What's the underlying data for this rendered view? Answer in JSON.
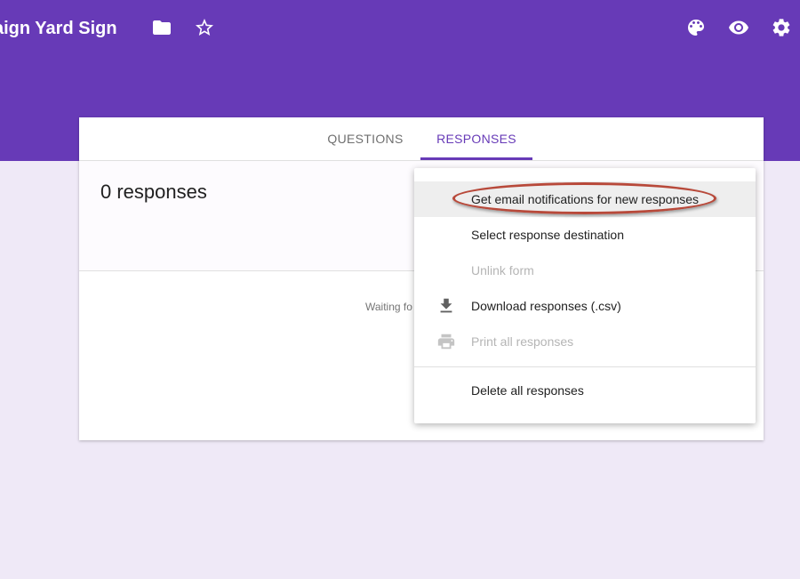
{
  "header": {
    "title": "mpaign Yard Sign",
    "icons": {
      "folder": "folder-icon",
      "star": "star-outline-icon",
      "palette": "palette-icon",
      "preview": "eye-icon",
      "settings": "gear-icon"
    },
    "color": "#673ab7"
  },
  "tabs": [
    {
      "label": "QUESTIONS",
      "active": false
    },
    {
      "label": "RESPONSES",
      "active": true
    }
  ],
  "summary": {
    "count_label": "0 responses",
    "waiting_text": "Waiting fo"
  },
  "menu": {
    "items": [
      {
        "label": "Get email notifications for new responses",
        "icon": "",
        "disabled": false,
        "highlighted": true
      },
      {
        "label": "Select response destination",
        "icon": "",
        "disabled": false,
        "highlighted": false
      },
      {
        "label": "Unlink form",
        "icon": "",
        "disabled": true,
        "highlighted": false
      },
      {
        "label": "Download responses (.csv)",
        "icon": "download-icon",
        "disabled": false,
        "highlighted": false
      },
      {
        "label": "Print all responses",
        "icon": "printer-icon",
        "disabled": true,
        "highlighted": false
      },
      {
        "label": "Delete all responses",
        "icon": "",
        "disabled": false,
        "highlighted": false
      }
    ]
  },
  "colors": {
    "accent": "#673ab7",
    "annotation": "#b8493a",
    "background": "#efe9f7"
  }
}
